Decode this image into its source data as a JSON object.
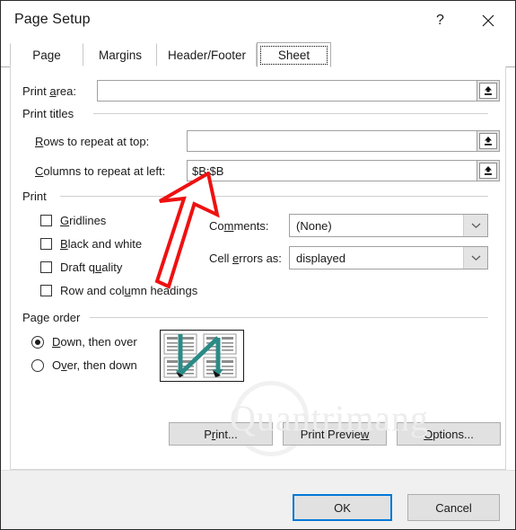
{
  "window": {
    "title": "Page Setup",
    "help_icon": "question-mark-icon",
    "close_icon": "close-icon"
  },
  "tabs": [
    {
      "label": "Page",
      "active": false
    },
    {
      "label": "Margins",
      "active": false
    },
    {
      "label": "Header/Footer",
      "active": false
    },
    {
      "label": "Sheet",
      "active": true
    }
  ],
  "sheet": {
    "print_area": {
      "label_pre": "Print ",
      "label_key": "a",
      "label_post": "rea:",
      "value": "",
      "collapse_icon": "collapse-dialog-icon"
    },
    "print_titles": {
      "group_label": "Print titles",
      "rows": {
        "label_key": "R",
        "label_post": "ows to repeat at top:",
        "value": "",
        "collapse_icon": "collapse-dialog-icon"
      },
      "columns": {
        "label_key": "C",
        "label_post": "olumns to repeat at left:",
        "value": "$B:$B",
        "collapse_icon": "collapse-dialog-icon"
      }
    },
    "print": {
      "group_label": "Print",
      "checkboxes": [
        {
          "pre": "",
          "key": "G",
          "post": "ridlines",
          "checked": false
        },
        {
          "pre": "",
          "key": "B",
          "post": "lack and white",
          "checked": false
        },
        {
          "pre": "Draft q",
          "key": "u",
          "post": "ality",
          "checked": false
        },
        {
          "pre": "Row and col",
          "key": "u",
          "post": "mn headings",
          "checked": false
        }
      ],
      "comments": {
        "label_pre": "Co",
        "label_key": "m",
        "label_post": "ments:",
        "value": "(None)",
        "arrow_icon": "chevron-down-icon"
      },
      "cell_errors": {
        "label_pre": "Cell ",
        "label_key": "e",
        "label_post": "rrors as:",
        "value": "displayed",
        "arrow_icon": "chevron-down-icon"
      }
    },
    "page_order": {
      "group_label": "Page order",
      "options": [
        {
          "pre": "",
          "key": "D",
          "post": "own, then over",
          "selected": true
        },
        {
          "pre": "O",
          "key": "v",
          "post": "er, then down",
          "selected": false
        }
      ],
      "preview_icon": "page-order-preview-icon"
    }
  },
  "action_buttons": [
    {
      "pre": "P",
      "key": "r",
      "post": "int..."
    },
    {
      "pre": "Print Previe",
      "key": "w",
      "post": ""
    },
    {
      "pre": "",
      "key": "O",
      "post": "ptions..."
    }
  ],
  "footer_buttons": {
    "ok": "OK",
    "cancel": "Cancel"
  },
  "watermark": {
    "text": "Quantrimang"
  },
  "annotation": {
    "type": "red-arrow",
    "color": "#ee1111",
    "points_to": "columns-to-repeat-at-left-input"
  },
  "colors": {
    "accent": "#0078d7",
    "annotation_red": "#ee1111",
    "preview_teal": "#2b8a86",
    "button_face": "#e1e1e1",
    "footer_bg": "#f0f0f0"
  }
}
